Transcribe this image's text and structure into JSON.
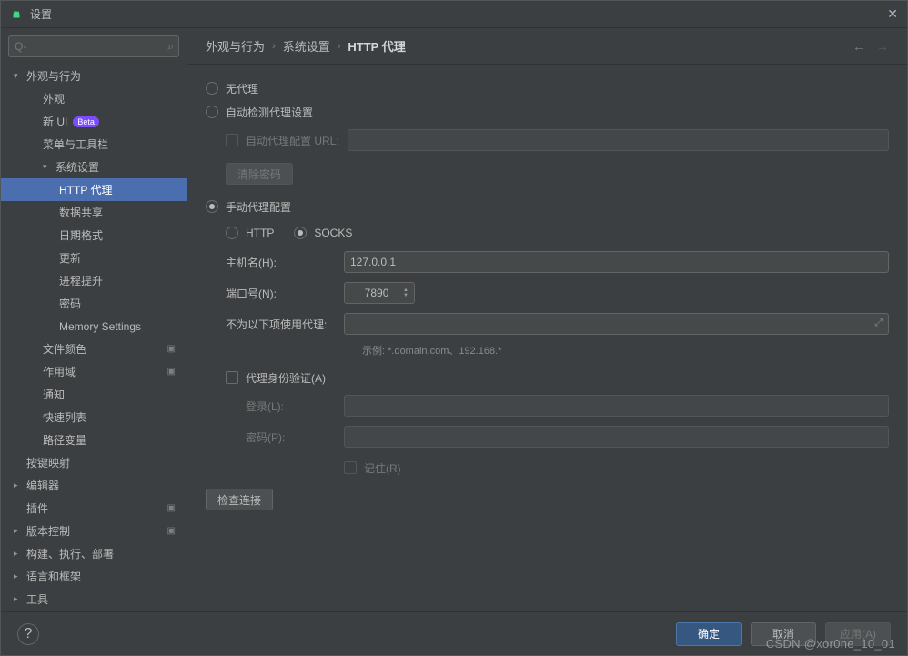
{
  "window": {
    "title": "设置"
  },
  "search": {
    "placeholder": "Q-"
  },
  "sidebar": [
    {
      "label": "外观与行为",
      "level": 0,
      "arrow": "down"
    },
    {
      "label": "外观",
      "level": 1
    },
    {
      "label": "新 UI",
      "level": 1,
      "beta": "Beta"
    },
    {
      "label": "菜单与工具栏",
      "level": 1
    },
    {
      "label": "系统设置",
      "level": 1,
      "arrow": "down"
    },
    {
      "label": "HTTP 代理",
      "level": 2,
      "selected": true
    },
    {
      "label": "数据共享",
      "level": 2
    },
    {
      "label": "日期格式",
      "level": 2
    },
    {
      "label": "更新",
      "level": 2
    },
    {
      "label": "进程提升",
      "level": 2
    },
    {
      "label": "密码",
      "level": 2
    },
    {
      "label": "Memory Settings",
      "level": 2
    },
    {
      "label": "文件颜色",
      "level": 1,
      "box": true
    },
    {
      "label": "作用域",
      "level": 1,
      "box": true
    },
    {
      "label": "通知",
      "level": 1
    },
    {
      "label": "快速列表",
      "level": 1
    },
    {
      "label": "路径变量",
      "level": 1
    },
    {
      "label": "按键映射",
      "level": 0
    },
    {
      "label": "编辑器",
      "level": 0,
      "arrow": "right"
    },
    {
      "label": "插件",
      "level": 0,
      "lang": true,
      "box": true
    },
    {
      "label": "版本控制",
      "level": 0,
      "arrow": "right",
      "box": true
    },
    {
      "label": "构建、执行、部署",
      "level": 0,
      "arrow": "right"
    },
    {
      "label": "语言和框架",
      "level": 0,
      "arrow": "right"
    },
    {
      "label": "工具",
      "level": 0,
      "arrow": "right"
    }
  ],
  "breadcrumb": {
    "a": "外观与行为",
    "b": "系统设置",
    "c": "HTTP 代理"
  },
  "proxy": {
    "no_proxy": "无代理",
    "auto_detect": "自动检测代理设置",
    "auto_url": "自动代理配置 URL:",
    "clear_pw": "清除密码",
    "manual": "手动代理配置",
    "type_http": "HTTP",
    "type_socks": "SOCKS",
    "host_label": "主机名(H):",
    "host_value": "127.0.0.1",
    "port_label": "端口号(N):",
    "port_value": "7890",
    "exclude_label": "不为以下项使用代理:",
    "exclude_hint": "示例: *.domain.com、192.168.*",
    "auth_label": "代理身份验证(A)",
    "login_label": "登录(L):",
    "pw_label": "密码(P):",
    "remember": "记住(R)",
    "check_conn": "检查连接"
  },
  "footer": {
    "ok": "确定",
    "cancel": "取消",
    "apply": "应用(A)"
  },
  "watermark": "CSDN @xor0ne_10_01"
}
